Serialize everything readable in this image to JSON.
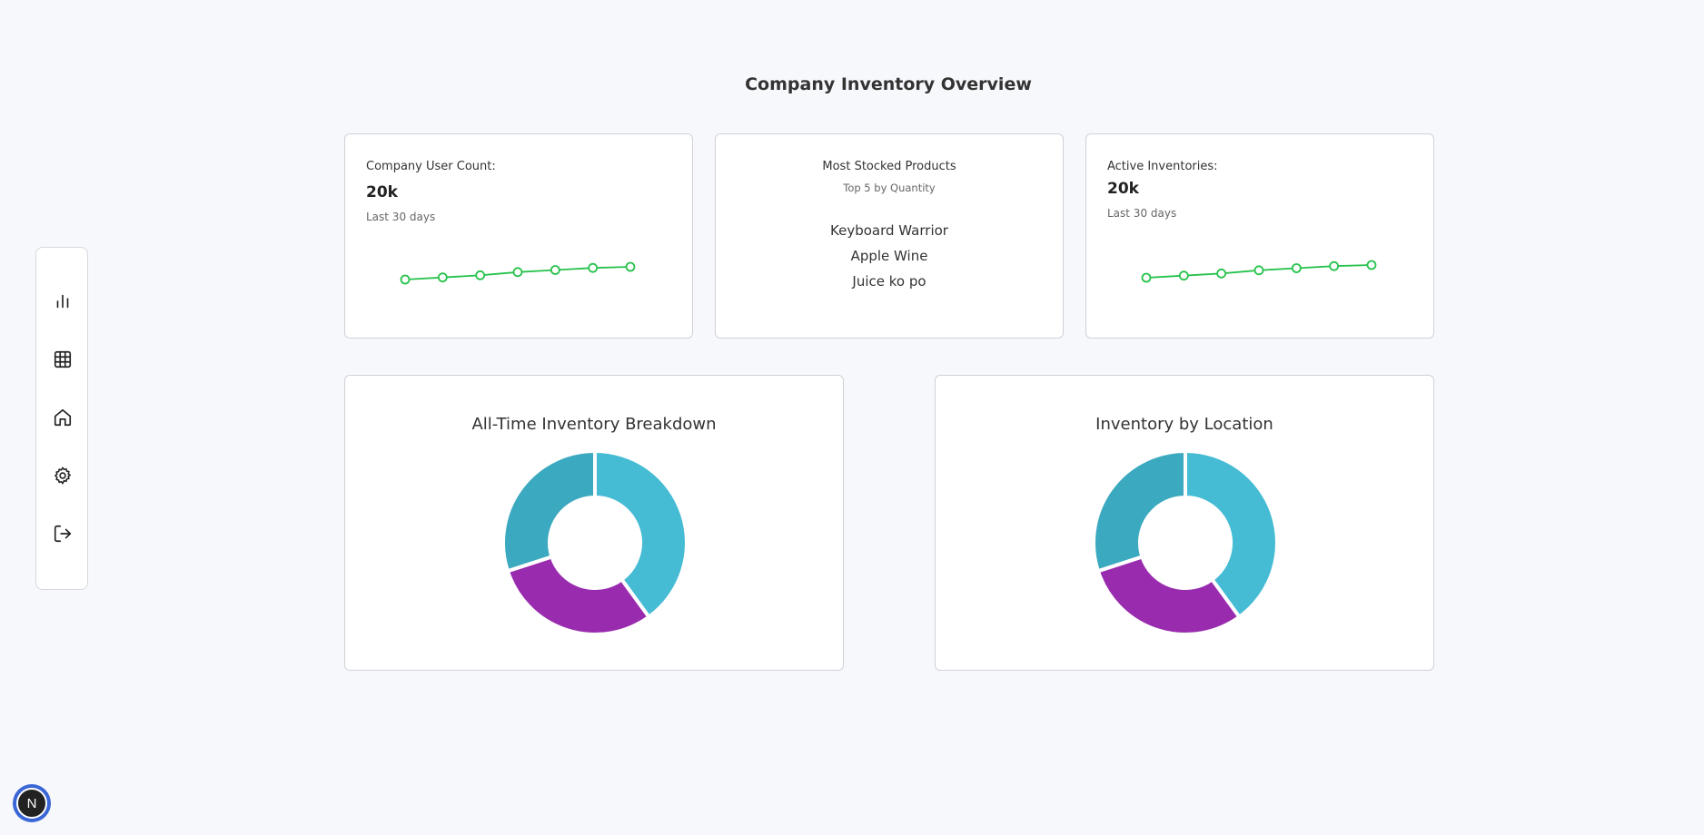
{
  "page": {
    "title": "Company Inventory Overview"
  },
  "sidebar": {
    "items": [
      {
        "icon": "bar-chart-icon"
      },
      {
        "icon": "table-grid-icon"
      },
      {
        "icon": "home-icon"
      },
      {
        "icon": "gear-icon"
      },
      {
        "icon": "logout-icon"
      }
    ]
  },
  "cards": {
    "user_count": {
      "label": "Company User Count:",
      "value": "20k",
      "period": "Last 30 days",
      "trend": [
        0,
        1,
        2,
        3.5,
        4.5,
        5.5,
        6
      ]
    },
    "top_products": {
      "title": "Most Stocked Products",
      "subtitle": "Top 5 by Quantity",
      "items": [
        "Keyboard Warrior",
        "Apple Wine",
        "Juice ko po"
      ]
    },
    "active_inventories": {
      "label": "Active Inventories:",
      "value": "20k",
      "period": "Last 30 days",
      "trend": [
        0,
        1,
        2,
        3.5,
        4.5,
        5.5,
        6
      ]
    }
  },
  "chart_data": [
    {
      "type": "pie",
      "title": "All-Time Inventory Breakdown",
      "values": [
        40,
        30,
        30
      ],
      "colors": [
        "#45bcd4",
        "#992cae",
        "#3ba9bf"
      ]
    },
    {
      "type": "pie",
      "title": "Inventory by Location",
      "values": [
        40,
        30,
        30
      ],
      "colors": [
        "#45bcd4",
        "#992cae",
        "#3ba9bf"
      ]
    }
  ],
  "badge": {
    "letter": "N"
  },
  "colors": {
    "spark": "#27c24c",
    "background": "#f7f8fb"
  }
}
